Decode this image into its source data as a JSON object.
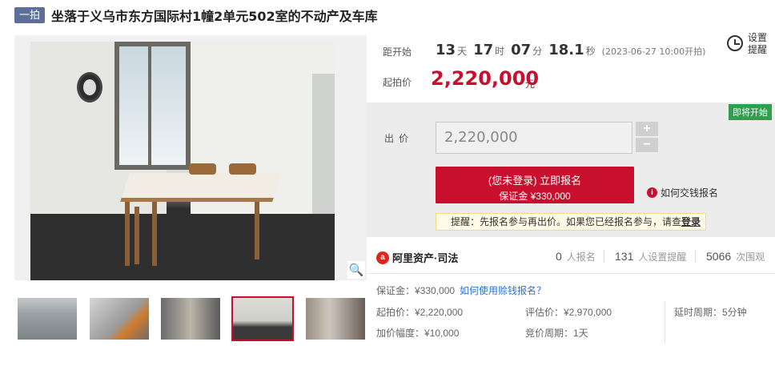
{
  "title": {
    "tag": "一拍",
    "text": "坐落于义乌市东方国际村1幢2单元502室的不动产及车库"
  },
  "countdown": {
    "label": "距开始",
    "days": "13",
    "days_unit": "天",
    "hours": "17",
    "hours_unit": "时",
    "minutes": "07",
    "minutes_unit": "分",
    "seconds": "18.1",
    "seconds_unit": "秒",
    "start_text": "(2023-06-27 10:00开拍)"
  },
  "reminder": {
    "label": "设置提醒",
    "icon": "alarm-clock-icon"
  },
  "starting_price": {
    "label": "起拍价",
    "value": "2,220,000",
    "unit": "元"
  },
  "bid": {
    "status": "即将开始",
    "label": "出价",
    "input_value": "2,220,000",
    "plus": "+",
    "minus": "−",
    "signup_line1": "(您未登录) 立即报名",
    "signup_line2": "保证金 ¥330,000",
    "howto": "如何交钱报名",
    "notice_prefix": "提醒：先报名参与再出价。如果您已经报名参与，请查",
    "notice_link": "登录"
  },
  "stats": {
    "brand": "阿里资产·司法",
    "signups_num": "0",
    "signups_label": "人报名",
    "reminders_num": "131",
    "reminders_label": "人设置提醒",
    "views_num": "5066",
    "views_label": "次围观"
  },
  "details": {
    "deposit": "保证金：¥330,000",
    "deposit_link": "如何使用赊钱报名？",
    "start_price": "起拍价：¥2,220,000",
    "increment": "加价幅度：¥10,000",
    "appraisal": "评估价：¥2,970,000",
    "bid_cycle": "竞价周期：1天",
    "delay": "延时周期：5分钟"
  },
  "colors": {
    "accent": "#c8102e",
    "status_green": "#2e9e4f",
    "tag_blue": "#5b6f9a",
    "link_blue": "#2b73cc"
  }
}
